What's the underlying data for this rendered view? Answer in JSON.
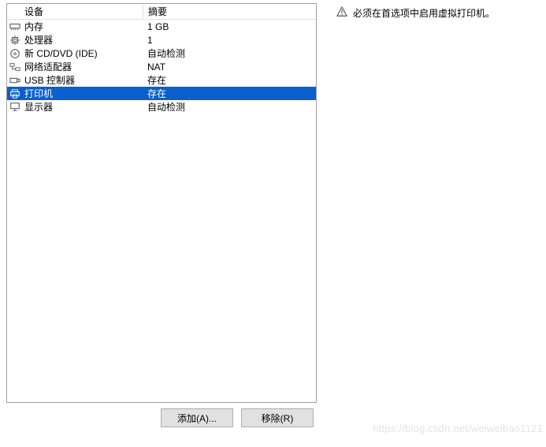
{
  "headers": {
    "device": "设备",
    "summary": "摘要"
  },
  "rows": [
    {
      "icon": "memory-icon",
      "label": "内存",
      "summary": "1 GB",
      "selected": false
    },
    {
      "icon": "cpu-icon",
      "label": "处理器",
      "summary": "1",
      "selected": false
    },
    {
      "icon": "cd-icon",
      "label": "新 CD/DVD (IDE)",
      "summary": "自动检测",
      "selected": false
    },
    {
      "icon": "network-icon",
      "label": "网络适配器",
      "summary": "NAT",
      "selected": false
    },
    {
      "icon": "usb-icon",
      "label": "USB 控制器",
      "summary": "存在",
      "selected": false
    },
    {
      "icon": "printer-icon",
      "label": "打印机",
      "summary": "存在",
      "selected": true
    },
    {
      "icon": "display-icon",
      "label": "显示器",
      "summary": "自动检测",
      "selected": false
    }
  ],
  "note_text": "必须在首选项中启用虚拟打印机。",
  "buttons": {
    "add": "添加(A)...",
    "remove": "移除(R)"
  },
  "watermark": "https://blog.csdn.net/weiweibao1121"
}
